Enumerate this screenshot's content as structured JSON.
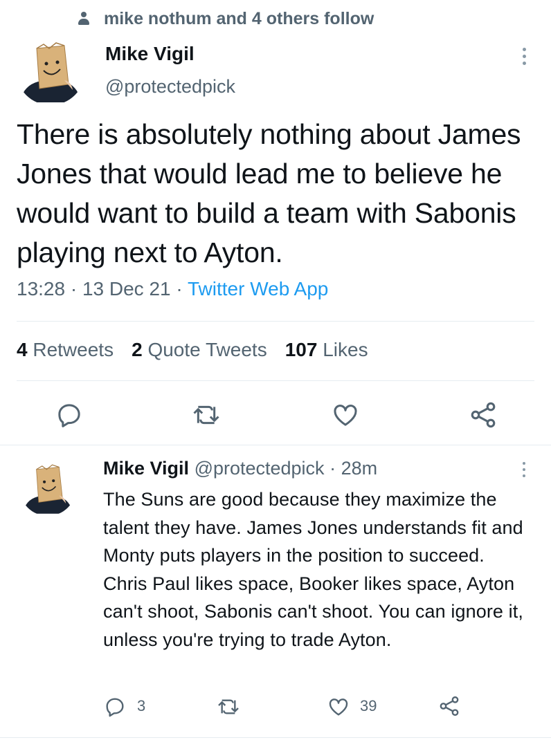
{
  "social_context": {
    "text": "mike nothum and 4 others follow",
    "icon": "person-icon"
  },
  "main_tweet": {
    "author_name": "Mike Vigil",
    "author_handle": "@protectedpick",
    "text": "There is absolutely nothing about James Jones that would lead me to believe he would want to build a team with Sabonis playing next to Ayton.",
    "time": "13:28",
    "separator": "·",
    "date": "13 Dec 21",
    "source": "Twitter Web App",
    "stats": {
      "retweets_count": "4",
      "retweets_label": "Retweets",
      "quotes_count": "2",
      "quotes_label": "Quote Tweets",
      "likes_count": "107",
      "likes_label": "Likes"
    }
  },
  "reply": {
    "author_name": "Mike Vigil",
    "author_handle": "@protectedpick",
    "separator": "·",
    "time_ago": "28m",
    "text": "The Suns are good because they maximize the talent they have. James Jones understands fit and Monty puts players in the position to succeed. Chris Paul likes space, Booker likes space, Ayton can't shoot, Sabonis can't shoot. You can ignore it, unless you're trying to trade Ayton.",
    "reply_count": "3",
    "like_count": "39"
  },
  "colors": {
    "accent": "#1d9bf0",
    "secondary_text": "#536471",
    "divider": "#e6ecf0"
  }
}
